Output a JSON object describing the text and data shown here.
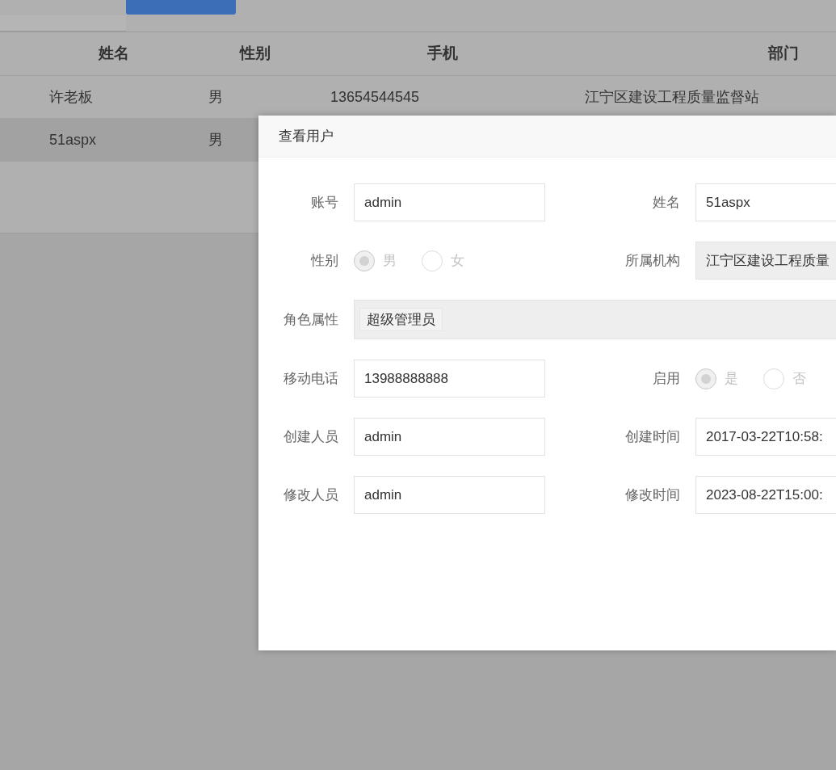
{
  "table": {
    "columns": [
      "姓名",
      "性别",
      "手机",
      "部门"
    ],
    "rows": [
      {
        "cells": [
          "许老板",
          "男",
          "13654544545",
          "江宁区建设工程质量监督站"
        ],
        "selected": false
      },
      {
        "cells": [
          "51aspx",
          "男"
        ],
        "selected": true
      }
    ]
  },
  "dialog": {
    "title": "查看用户",
    "rows": [
      {
        "fields": [
          {
            "kind": "text",
            "label": "账号",
            "value": "admin",
            "disabled": false
          },
          {
            "kind": "text",
            "label": "姓名",
            "value": "51aspx",
            "disabled": false
          }
        ]
      },
      {
        "fields": [
          {
            "kind": "radio",
            "label": "性别",
            "options": [
              {
                "label": "男",
                "selected": true
              },
              {
                "label": "女",
                "selected": false
              }
            ]
          },
          {
            "kind": "text",
            "label": "所属机构",
            "value": "江宁区建设工程质量",
            "disabled": true
          }
        ]
      },
      {
        "fields": [
          {
            "kind": "tags",
            "label": "角色属性",
            "tags": [
              "超级管理员"
            ]
          }
        ]
      },
      {
        "fields": [
          {
            "kind": "text",
            "label": "移动电话",
            "value": "13988888888",
            "disabled": false
          },
          {
            "kind": "radio",
            "label": "启用",
            "options": [
              {
                "label": "是",
                "selected": true
              },
              {
                "label": "否",
                "selected": false
              }
            ]
          }
        ]
      },
      {
        "fields": [
          {
            "kind": "text",
            "label": "创建人员",
            "value": "admin",
            "disabled": false
          },
          {
            "kind": "text",
            "label": "创建时间",
            "value": "2017-03-22T10:58:",
            "disabled": false
          }
        ]
      },
      {
        "fields": [
          {
            "kind": "text",
            "label": "修改人员",
            "value": "admin",
            "disabled": false
          },
          {
            "kind": "text",
            "label": "修改时间",
            "value": "2023-08-22T15:00:",
            "disabled": false
          }
        ]
      }
    ]
  }
}
